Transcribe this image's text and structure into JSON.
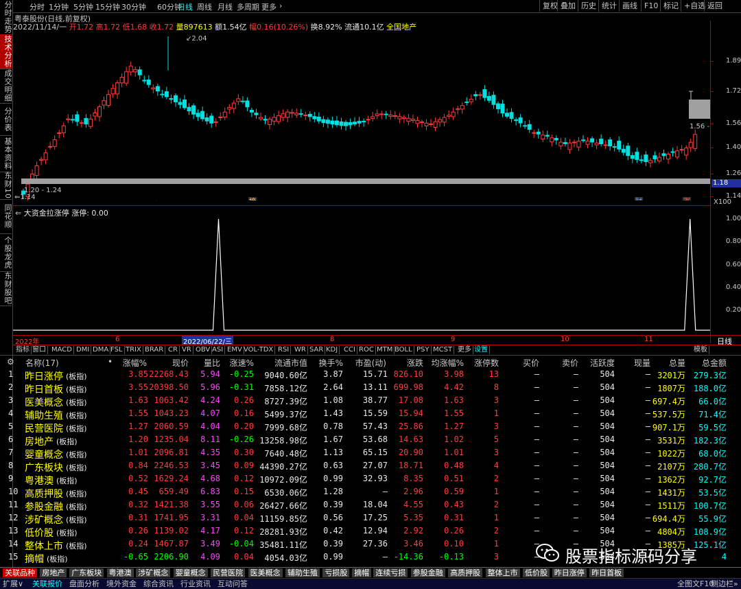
{
  "left_tabs": [
    "分时走势",
    "技术分析",
    "成交明细",
    "分价表",
    "基本资料",
    "东财10",
    "同花顺",
    "个股龙虎",
    "东财股吧"
  ],
  "top_bar": {
    "periods": [
      "分时",
      "1分钟",
      "5分钟",
      "15分钟",
      "30分钟",
      "60分钟",
      "日线",
      "周线",
      "月线",
      "多周期",
      "更多"
    ],
    "active_period": "日线",
    "right_buttons": [
      "复权",
      "叠加",
      "历史",
      "统计",
      "画线",
      "F10",
      "标记",
      "+自选",
      "返回"
    ]
  },
  "stock_info": {
    "name": "粤泰股份(日线,前复权)",
    "date": "2022/11/14/一",
    "open_label": "开",
    "open": "1.72",
    "high_label": "高",
    "high": "1.72",
    "low_label": "低",
    "low": "1.68",
    "close_label": "收",
    "close": "1.72",
    "vol_label": "量",
    "vol": "897613",
    "amount_label": "额",
    "amount": "1.54亿",
    "change_label": "幅",
    "change": "0.16(10.26%)",
    "turnover_label": "换",
    "turnover": "8.92%",
    "float_label": "流通",
    "float": "10.1亿",
    "concept": "全国地产"
  },
  "chart_data": {
    "type": "candlestick",
    "y_ticks": [
      "1.89",
      "1.72",
      "1.56",
      "1.40",
      "1.26",
      "1.14"
    ],
    "range_label": "1.20 - 1.24",
    "high_mark": "2.04",
    "low_mark": "1.14",
    "right_box": "1.56",
    "axis_price": "1.18",
    "axis_scale": "X100",
    "markers": [
      "榜",
      "财",
      "涨"
    ],
    "x_labels": [
      "2022年",
      "6",
      "2022/06/22/三",
      "8",
      "9",
      "10",
      "11"
    ],
    "right_label": "日线"
  },
  "indicator": {
    "title": "大资金拉涨停",
    "value_label": "涨停: 0.00",
    "y_ticks": [
      "1.00",
      "0.80",
      "0.60",
      "0.40",
      "0.20"
    ],
    "spikes": [
      0.2948,
      0.9712
    ]
  },
  "indicator_tabs": [
    "指标",
    "窗口",
    "MACD",
    "DMI",
    "DMA",
    "FSL",
    "TRIX",
    "BRAR",
    "CR",
    "VR",
    "OBV",
    "ASI",
    "EMV",
    "VOL-TDX",
    "RSI",
    "WR",
    "SAR",
    "KDJ",
    "CCI",
    "ROC",
    "MTM",
    "BOLL",
    "PSY",
    "MCST",
    "更多",
    "设置",
    "模板"
  ],
  "table": {
    "headers": [
      "名称(17)",
      "涨幅%",
      "现价",
      "量比",
      "涨速%",
      "流通市值",
      "换手%",
      "市盈(动)",
      "涨跌",
      "均涨幅%",
      "涨停数",
      "买价",
      "卖价",
      "活跃度",
      "现量",
      "总量",
      "总金额"
    ],
    "rows": [
      [
        "1",
        "昨日涨停",
        "(板指)",
        "3.85",
        "22268.43",
        "5.94",
        "-0.25",
        "9040.60亿",
        "3.87",
        "15.71",
        "826.10",
        "3.98",
        "13",
        "—",
        "—",
        "504",
        "—",
        "3201万",
        "279.3亿"
      ],
      [
        "2",
        "昨日首板",
        "(板指)",
        "3.55",
        "20398.50",
        "5.96",
        "-0.31",
        "7858.12亿",
        "2.64",
        "13.11",
        "699.98",
        "4.42",
        "8",
        "—",
        "—",
        "504",
        "—",
        "1807万",
        "188.0亿"
      ],
      [
        "3",
        "医美概念",
        "(板指)",
        "1.63",
        "1063.42",
        "4.24",
        "0.26",
        "8727.39亿",
        "1.08",
        "38.77",
        "17.08",
        "1.63",
        "3",
        "—",
        "—",
        "504",
        "—",
        "697.4万",
        "66.0亿"
      ],
      [
        "4",
        "辅助生殖",
        "(板指)",
        "1.55",
        "1043.23",
        "4.07",
        "0.16",
        "5499.37亿",
        "1.43",
        "15.59",
        "15.94",
        "1.55",
        "1",
        "—",
        "—",
        "504",
        "—",
        "537.5万",
        "71.4亿"
      ],
      [
        "5",
        "民营医院",
        "(板指)",
        "1.27",
        "2060.59",
        "4.04",
        "0.20",
        "7999.68亿",
        "0.78",
        "57.43",
        "25.86",
        "1.27",
        "3",
        "—",
        "—",
        "504",
        "—",
        "907.1万",
        "59.5亿"
      ],
      [
        "6",
        "房地产",
        "(板指)",
        "1.20",
        "1235.04",
        "8.11",
        "-0.26",
        "13258.98亿",
        "1.67",
        "53.68",
        "14.63",
        "1.02",
        "5",
        "—",
        "—",
        "504",
        "—",
        "3531万",
        "182.3亿"
      ],
      [
        "7",
        "婴童概念",
        "(板指)",
        "1.01",
        "2096.81",
        "4.35",
        "0.30",
        "7640.48亿",
        "1.13",
        "65.15",
        "20.90",
        "1.01",
        "3",
        "—",
        "—",
        "504",
        "—",
        "1022万",
        "68.0亿"
      ],
      [
        "8",
        "广东板块",
        "(板指)",
        "0.84",
        "2246.53",
        "3.45",
        "0.09",
        "44390.27亿",
        "0.63",
        "27.07",
        "18.71",
        "0.48",
        "4",
        "—",
        "—",
        "504",
        "—",
        "2107万",
        "280.7亿"
      ],
      [
        "9",
        "粤港澳",
        "(板指)",
        "0.52",
        "1629.24",
        "4.68",
        "0.12",
        "10972.09亿",
        "0.99",
        "32.93",
        "8.35",
        "0.51",
        "2",
        "—",
        "—",
        "504",
        "—",
        "1362万",
        "92.7亿"
      ],
      [
        "10",
        "高质押股",
        "(板指)",
        "0.45",
        "659.49",
        "6.83",
        "0.15",
        "6530.06亿",
        "1.28",
        "—",
        "2.96",
        "0.59",
        "1",
        "—",
        "—",
        "504",
        "—",
        "1431万",
        "53.5亿"
      ],
      [
        "11",
        "参股金融",
        "(板指)",
        "0.32",
        "1421.38",
        "3.55",
        "0.06",
        "26427.66亿",
        "0.39",
        "18.04",
        "4.55",
        "0.43",
        "2",
        "—",
        "—",
        "504",
        "—",
        "1511万",
        "100.7亿"
      ],
      [
        "12",
        "涉矿概念",
        "(板指)",
        "0.31",
        "1741.95",
        "3.31",
        "0.04",
        "11159.85亿",
        "0.56",
        "17.25",
        "5.35",
        "0.31",
        "1",
        "—",
        "—",
        "504",
        "—",
        "694.4万",
        "55.9亿"
      ],
      [
        "13",
        "低价股",
        "(板指)",
        "0.26",
        "1139.02",
        "4.17",
        "0.12",
        "28281.93亿",
        "0.42",
        "12.94",
        "2.92",
        "0.26",
        "2",
        "—",
        "—",
        "504",
        "—",
        "4804万",
        "108.9亿"
      ],
      [
        "14",
        "整体上市",
        "(板指)",
        "0.24",
        "1467.87",
        "3.49",
        "-0.04",
        "35481.11亿",
        "0.39",
        "27.36",
        "3.46",
        "0.10",
        "1",
        "—",
        "—",
        "504",
        "—",
        "1385万",
        "125.1亿"
      ],
      [
        "15",
        "摘帽",
        "(板指)",
        "-0.65",
        "2206.90",
        "4.09",
        "0.04",
        "4054.03亿",
        "0.99",
        "—",
        "-14.36",
        "-0.13",
        "3",
        "—",
        "—",
        "504",
        "—",
        "",
        "4"
      ]
    ]
  },
  "sector_tabs": [
    "关联品种",
    "房地产",
    "广东板块",
    "粤港澳",
    "涉矿概念",
    "婴童概念",
    "民营医院",
    "医美概念",
    "辅助生殖",
    "亏损股",
    "摘帽",
    "连续亏损",
    "参股金融",
    "高质押股",
    "整体上市",
    "低价股",
    "昨日涨停",
    "昨日首板"
  ],
  "status_bar": {
    "items": [
      "扩展∨",
      "关联报价",
      "盘面分析",
      "境外资金",
      "综合资讯",
      "行业资讯",
      "互动问答"
    ],
    "right": "全图文F10",
    "right2": "侧边栏»"
  },
  "watermark": "股票指标源码分享",
  "colors": {
    "up": "#ff3c3c",
    "down": "#00e0e0",
    "accent": "#d00000"
  }
}
